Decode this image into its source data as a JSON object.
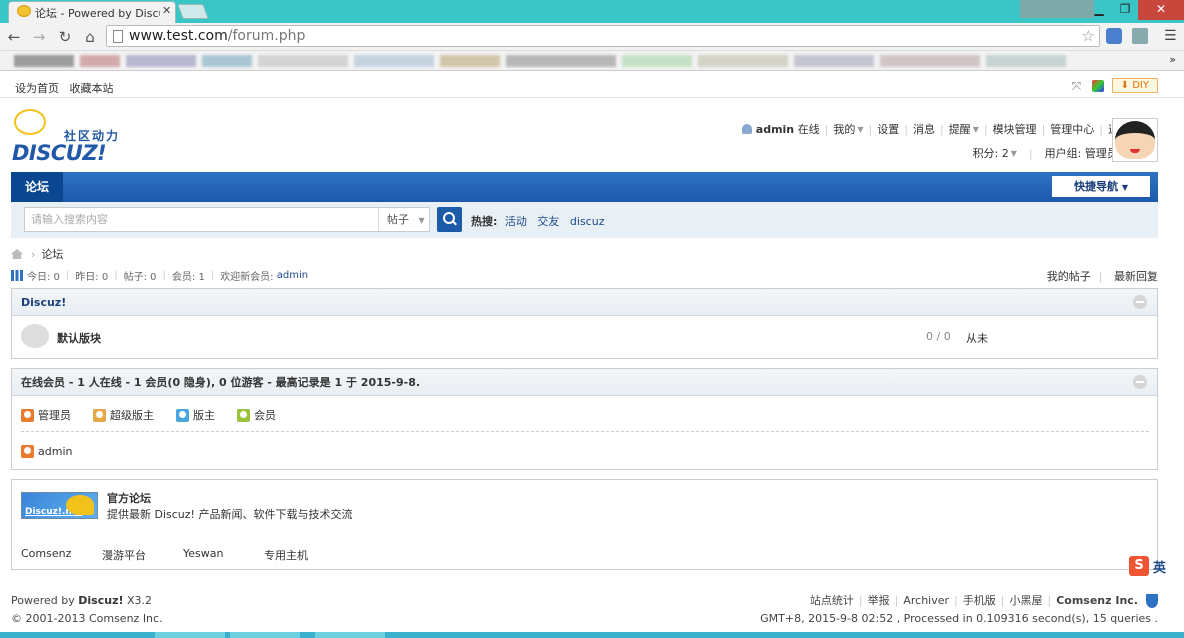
{
  "browser": {
    "tab_title": "论坛 - Powered by Discuz",
    "url_host": "www.test.com",
    "url_path": "/forum.php"
  },
  "topbar": {
    "left_links": [
      "设为首页",
      "收藏本站"
    ],
    "diy_label": "DIY"
  },
  "logo": {
    "cn": "社区动力",
    "en": "DISCUZ!"
  },
  "usernav": {
    "username": "admin",
    "status": "在线",
    "items": [
      "我的",
      "设置",
      "消息",
      "提醒",
      "模块管理",
      "管理中心",
      "退出"
    ],
    "credits": "积分: 2",
    "usergroup": "用户组: 管理员"
  },
  "nav": {
    "active_tab": "论坛",
    "quicknav": "快捷导航"
  },
  "search": {
    "placeholder": "请输入搜索内容",
    "type": "帖子",
    "hot_label": "热搜:",
    "hot_items": [
      "活动",
      "交友",
      "discuz"
    ]
  },
  "breadcrumb": {
    "current": "论坛"
  },
  "stats": {
    "today": "今日: 0",
    "yesterday": "昨日: 0",
    "posts": "帖子: 0",
    "members": "会员: 1",
    "newest_prefix": "欢迎新会员:",
    "newest_member": "admin",
    "my_posts": "我的帖子",
    "latest_replies": "最新回复"
  },
  "category": {
    "title": "Discuz!",
    "forum": {
      "name": "默认版块",
      "counts": "0 / 0",
      "last": "从未"
    }
  },
  "online": {
    "title": "在线会员 - 1 人在线 - 1 会员(0 隐身), 0 位游客 - 最高记录是 1 于 2015-9-8.",
    "legend": [
      {
        "label": "管理员",
        "color": "#e77b2e"
      },
      {
        "label": "超级版主",
        "color": "#e5a94a"
      },
      {
        "label": "版主",
        "color": "#4ba6dd"
      },
      {
        "label": "会员",
        "color": "#9ac23a"
      }
    ],
    "user": "admin",
    "user_color": "#e77b2e"
  },
  "links": {
    "img_label": "Discuz!.net",
    "title": "官方论坛",
    "desc": "提供最新 Discuz! 产品新闻、软件下载与技术交流",
    "items": [
      "Comsenz",
      "漫游平台",
      "Yeswan",
      "专用主机"
    ]
  },
  "footer": {
    "powered_prefix": "Powered by ",
    "powered_brand": "Discuz!",
    "version": " X3.2",
    "copyright": "© 2001-2013 Comsenz Inc.",
    "links": [
      "站点统计",
      "举报",
      "Archiver",
      "手机版",
      "小黑屋"
    ],
    "company": "Comsenz Inc.",
    "debug": "GMT+8, 2015-9-8 02:52 , Processed in 0.109316 second(s), 15 queries ."
  },
  "ime": {
    "s": "S",
    "lang": "英"
  },
  "colors": {
    "nav_blue": "#1c59aa",
    "link_blue": "#1d4a8a"
  }
}
